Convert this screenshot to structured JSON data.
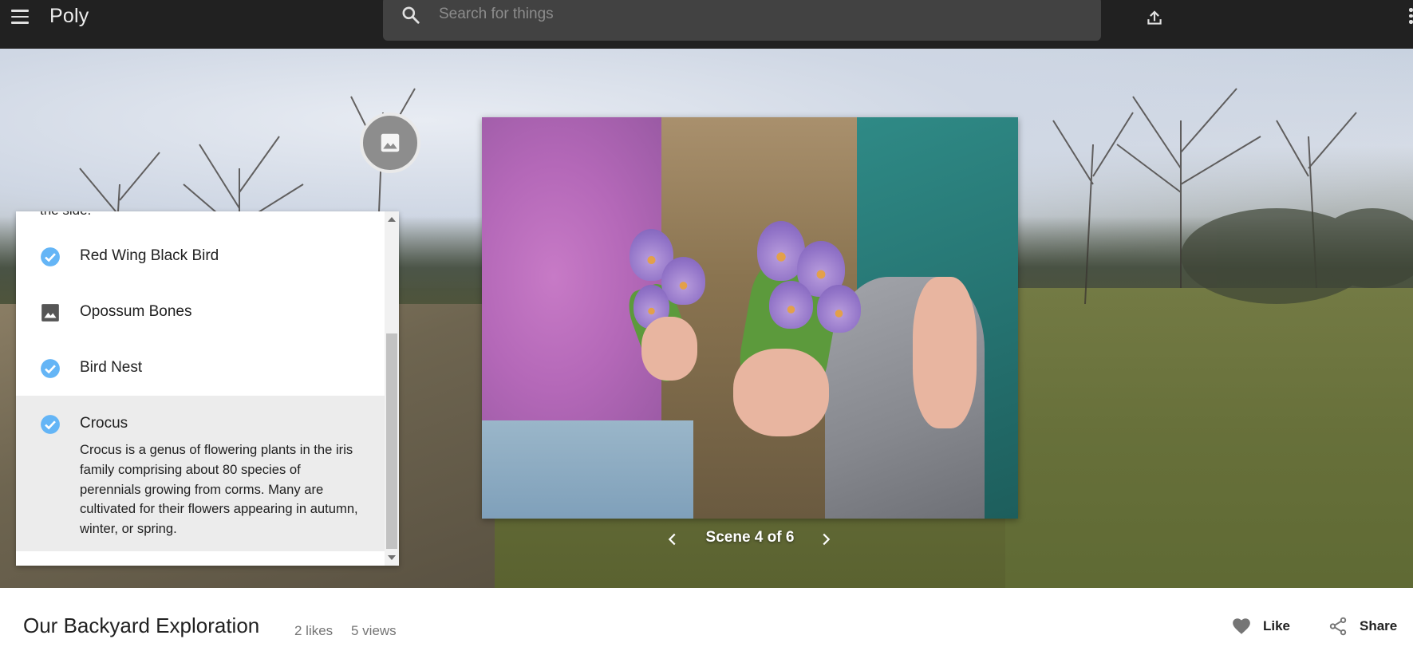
{
  "header": {
    "logo": "Poly",
    "search_placeholder": "Search for things",
    "menu_icon": "hamburger-menu-icon",
    "search_icon": "search-icon",
    "upload_icon": "upload-icon",
    "more_icon": "more-vertical-icon"
  },
  "viewer": {
    "scene_label": "Scene 4 of 6",
    "current_scene": 4,
    "total_scenes": 6,
    "scene_indicator_icon": "image-icon"
  },
  "panel": {
    "clipped_text": "the side.",
    "items": [
      {
        "label": "Red Wing Black Bird",
        "icon": "check-circle-icon",
        "status": "visited"
      },
      {
        "label": "Opossum Bones",
        "icon": "image-icon",
        "status": "unvisited"
      },
      {
        "label": "Bird Nest",
        "icon": "check-circle-icon",
        "status": "visited"
      },
      {
        "label": "Crocus",
        "icon": "check-circle-icon",
        "status": "visited",
        "description": "Crocus is a genus of flowering plants in the iris family comprising about 80 species of perennials growing from corms. Many are cultivated for their flowers appearing in autumn, winter, or spring."
      }
    ]
  },
  "info": {
    "title": "Our Backyard Exploration",
    "likes": "2 likes",
    "views": "5 views",
    "like_label": "Like",
    "share_label": "Share"
  },
  "colors": {
    "topbar": "#212121",
    "search_box": "#424242",
    "check_blue": "#64b5f6",
    "active_item_bg": "#ececec"
  }
}
